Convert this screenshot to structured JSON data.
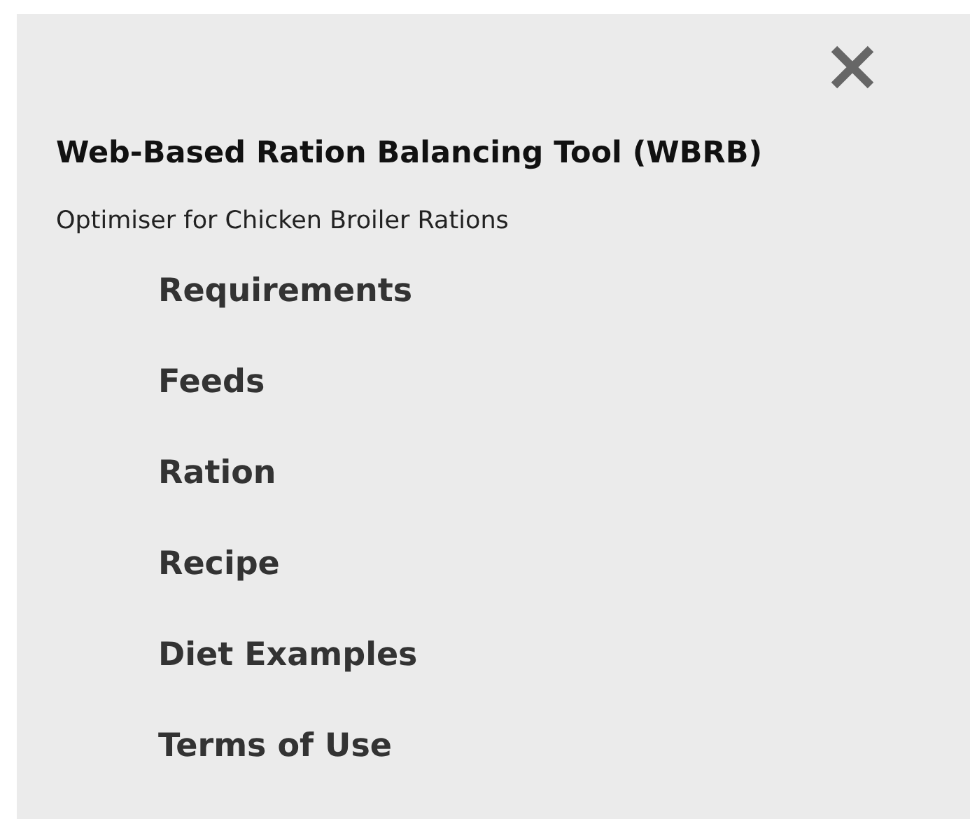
{
  "menu": {
    "title": "Web-Based Ration Balancing Tool (WBRB)",
    "subtitle": "Optimiser for Chicken Broiler Rations",
    "items": [
      "Requirements",
      "Feeds",
      "Ration",
      "Recipe",
      "Diet Examples",
      "Terms of Use"
    ]
  }
}
